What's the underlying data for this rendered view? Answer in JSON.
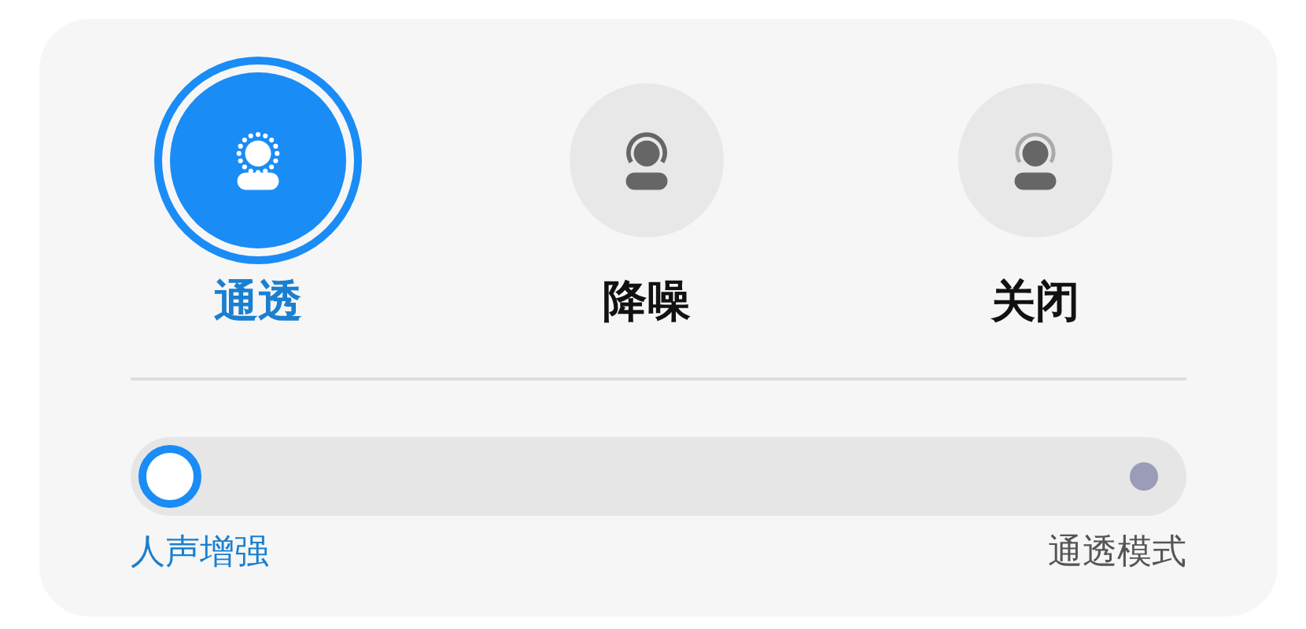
{
  "modes": [
    {
      "label": "通透",
      "kind": "transparency",
      "selected": true
    },
    {
      "label": "降噪",
      "kind": "noise_cancel",
      "selected": false
    },
    {
      "label": "关闭",
      "kind": "off",
      "selected": false
    }
  ],
  "slider": {
    "level": 0
  },
  "slider_labels": [
    {
      "label": "人声增强",
      "selected": true
    },
    {
      "label": "通透模式",
      "selected": false
    }
  ]
}
